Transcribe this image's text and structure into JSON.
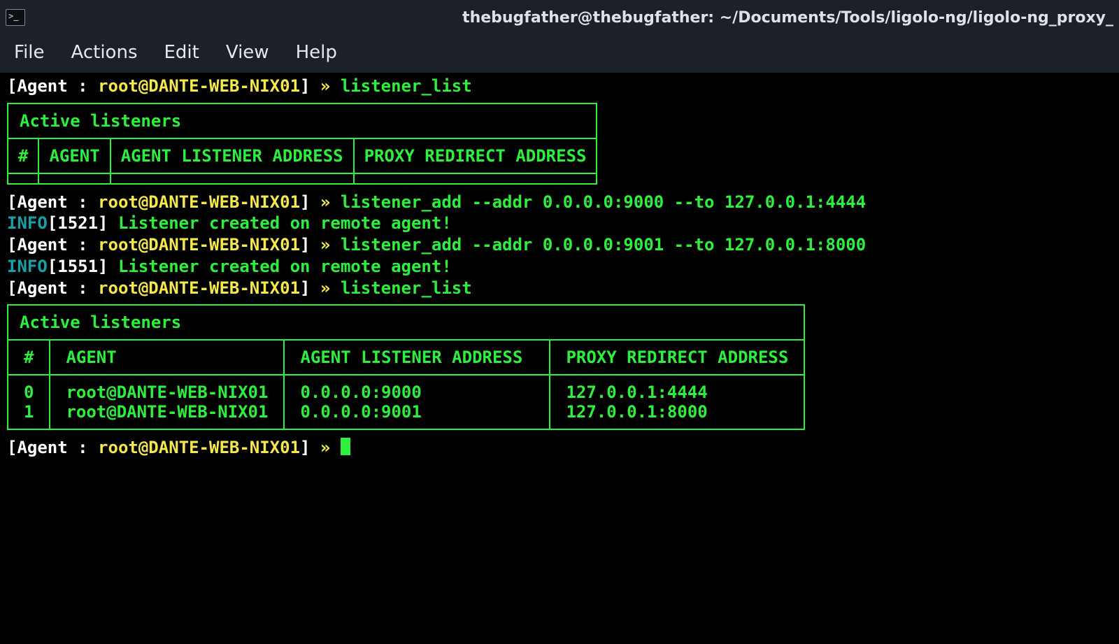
{
  "window": {
    "icon_glyph": ">_",
    "title": "thebugfather@thebugfather: ~/Documents/Tools/ligolo-ng/ligolo-ng_proxy_"
  },
  "menu": {
    "file": "File",
    "actions": "Actions",
    "edit": "Edit",
    "view": "View",
    "help": "Help"
  },
  "prompt": {
    "open": "[",
    "label": "Agent : ",
    "agent": "root@DANTE-WEB-NIX01",
    "close": "]",
    "arrow": " »",
    "sp": " "
  },
  "cmds": {
    "listener_list": "listener_list",
    "listener_add1": "listener_add --addr 0.0.0.0:9000 --to 127.0.0.1:4444",
    "listener_add2": "listener_add --addr 0.0.0.0:9001 --to 127.0.0.1:8000"
  },
  "info": {
    "prefix1": "INFO",
    "code1": "[1521]",
    "msg": " Listener created on remote agent!",
    "code2": "[1551]"
  },
  "table": {
    "caption": "Active listeners",
    "headers": {
      "idx": "#",
      "agent": "AGENT",
      "addr": "AGENT LISTENER ADDRESS",
      "proxy": "PROXY REDIRECT ADDRESS"
    },
    "empty_row": {
      "idx": " ",
      "agent": " ",
      "addr": " ",
      "proxy": " "
    },
    "rows": [
      {
        "idx": "0",
        "agent": "root@DANTE-WEB-NIX01",
        "addr": "0.0.0.0:9000",
        "proxy": "127.0.0.1:4444"
      },
      {
        "idx": "1",
        "agent": "root@DANTE-WEB-NIX01",
        "addr": "0.0.0.0:9001",
        "proxy": "127.0.0.1:8000"
      }
    ]
  }
}
